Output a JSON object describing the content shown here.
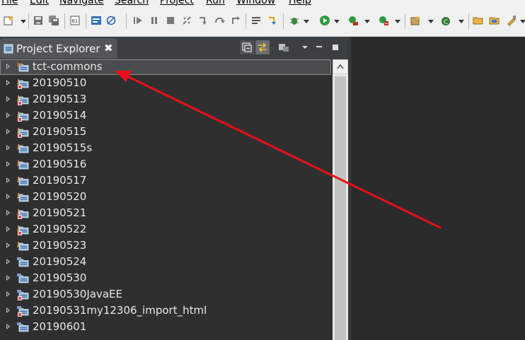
{
  "menu": {
    "items": [
      "File",
      "Edit",
      "Navigate",
      "Search",
      "Project",
      "Run",
      "Window",
      "Help"
    ]
  },
  "view": {
    "tab_title": "Project Explorer",
    "close_glyph": "✖"
  },
  "tree": {
    "projects": [
      {
        "name": "tct-commons",
        "icon": "maven-project-icon",
        "selected": true
      },
      {
        "name": "20190510",
        "icon": "java-project-error-icon"
      },
      {
        "name": "20190513",
        "icon": "java-project-error-icon"
      },
      {
        "name": "20190514",
        "icon": "java-project-error-icon"
      },
      {
        "name": "20190515",
        "icon": "java-project-error-icon"
      },
      {
        "name": "20190515s",
        "icon": "java-project-icon"
      },
      {
        "name": "20190516",
        "icon": "java-project-icon"
      },
      {
        "name": "20190517",
        "icon": "java-project-icon"
      },
      {
        "name": "20190520",
        "icon": "java-project-icon"
      },
      {
        "name": "20190521",
        "icon": "java-project-error-icon"
      },
      {
        "name": "20190522",
        "icon": "java-project-error-icon"
      },
      {
        "name": "20190523",
        "icon": "java-project-icon"
      },
      {
        "name": "20190524",
        "icon": "web-project-icon"
      },
      {
        "name": "20190530",
        "icon": "web-project-icon"
      },
      {
        "name": "20190530JavaEE",
        "icon": "web-project-error-icon"
      },
      {
        "name": "20190531my12306_import_html",
        "icon": "web-project-error-icon"
      },
      {
        "name": "20190601",
        "icon": "web-project-icon"
      }
    ]
  },
  "colors": {
    "annotation": "#e8101a",
    "error_badge": "#d9322b",
    "java_badge": "#e8a33d",
    "folder": "#9fbfe0"
  }
}
